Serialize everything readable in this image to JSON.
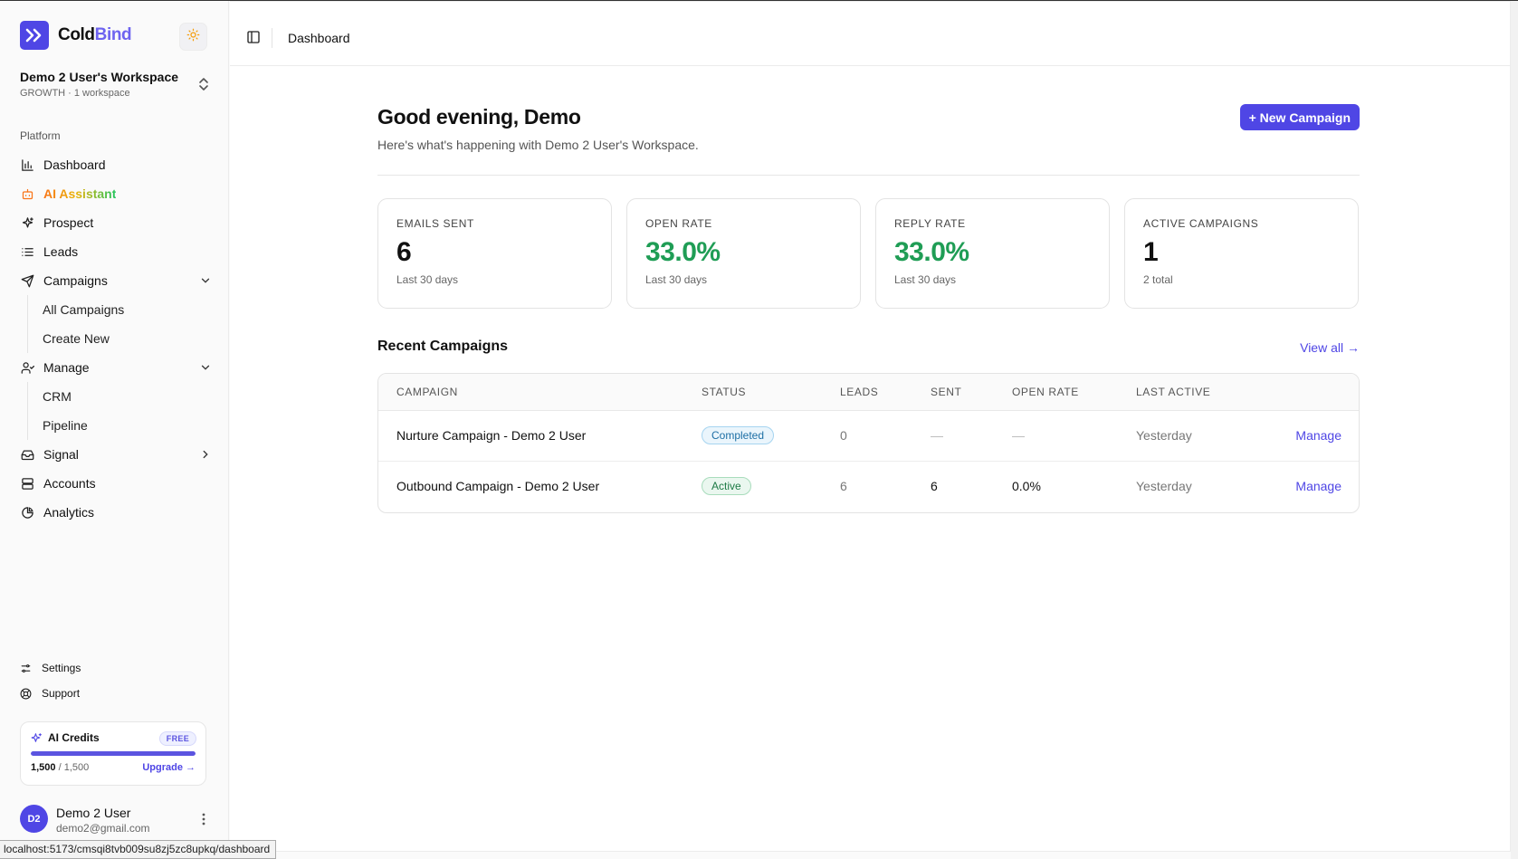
{
  "brand": {
    "name_part1": "Cold",
    "name_part2": "Bind"
  },
  "workspace": {
    "name": "Demo 2 User's Workspace",
    "sub": "GROWTH · 1 workspace"
  },
  "sidebar": {
    "section_label": "Platform",
    "items": [
      {
        "label": "Dashboard",
        "icon": "bar-chart-icon"
      },
      {
        "label": "AI Assistant",
        "icon": "bot-icon"
      },
      {
        "label": "Prospect",
        "icon": "sparkle-icon"
      },
      {
        "label": "Leads",
        "icon": "list-icon"
      },
      {
        "label": "Campaigns",
        "icon": "send-icon",
        "expanded": true,
        "children": [
          "All Campaigns",
          "Create New"
        ]
      },
      {
        "label": "Manage",
        "icon": "users-icon",
        "expanded": true,
        "children": [
          "CRM",
          "Pipeline"
        ]
      },
      {
        "label": "Signal",
        "icon": "inbox-icon",
        "expanded": false
      },
      {
        "label": "Accounts",
        "icon": "server-icon"
      },
      {
        "label": "Analytics",
        "icon": "pie-chart-icon"
      }
    ],
    "footer_links": [
      {
        "label": "Settings",
        "icon": "sliders-icon"
      },
      {
        "label": "Support",
        "icon": "lifebuoy-icon"
      }
    ]
  },
  "credits": {
    "title": "AI Credits",
    "badge": "FREE",
    "used": "1,500",
    "total": "/ 1,500",
    "fill_fraction": 1.0,
    "upgrade_label": "Upgrade →"
  },
  "user": {
    "initials": "D2",
    "name": "Demo 2 User",
    "email": "demo2@gmail.com"
  },
  "statusbar_url": "localhost:5173/cmsqi8tvb009su8zj5zc8upkq/dashboard",
  "header": {
    "breadcrumb": "Dashboard"
  },
  "main": {
    "greeting": "Good evening, Demo",
    "subtitle": "Here's what's happening with Demo 2 User's Workspace.",
    "new_campaign_label": "+ New Campaign",
    "stats": [
      {
        "label": "EMAILS SENT",
        "value": "6",
        "sub": "Last 30 days",
        "accent": "#111111"
      },
      {
        "label": "OPEN RATE",
        "value": "33.0%",
        "sub": "Last 30 days",
        "accent": "#1f9d55"
      },
      {
        "label": "REPLY RATE",
        "value": "33.0%",
        "sub": "Last 30 days",
        "accent": "#1f9d55"
      },
      {
        "label": "ACTIVE CAMPAIGNS",
        "value": "1",
        "sub": "2 total",
        "accent": "#111111"
      }
    ],
    "recent_title": "Recent Campaigns",
    "view_all_label": "View all →",
    "table": {
      "columns": [
        "CAMPAIGN",
        "STATUS",
        "LEADS",
        "SENT",
        "OPEN RATE",
        "LAST ACTIVE"
      ],
      "rows": [
        {
          "campaign": "Nurture Campaign - Demo 2 User",
          "status": "Completed",
          "leads": "0",
          "sent": "—",
          "open_rate": "—",
          "last_active": "Yesterday",
          "action": "Manage"
        },
        {
          "campaign": "Outbound Campaign - Demo 2 User",
          "status": "Active",
          "leads": "6",
          "sent": "6",
          "open_rate": "0.0%",
          "last_active": "Yesterday",
          "action": "Manage"
        }
      ]
    }
  },
  "colors": {
    "accent": "#4f46e5",
    "positive": "#1f9d55"
  }
}
